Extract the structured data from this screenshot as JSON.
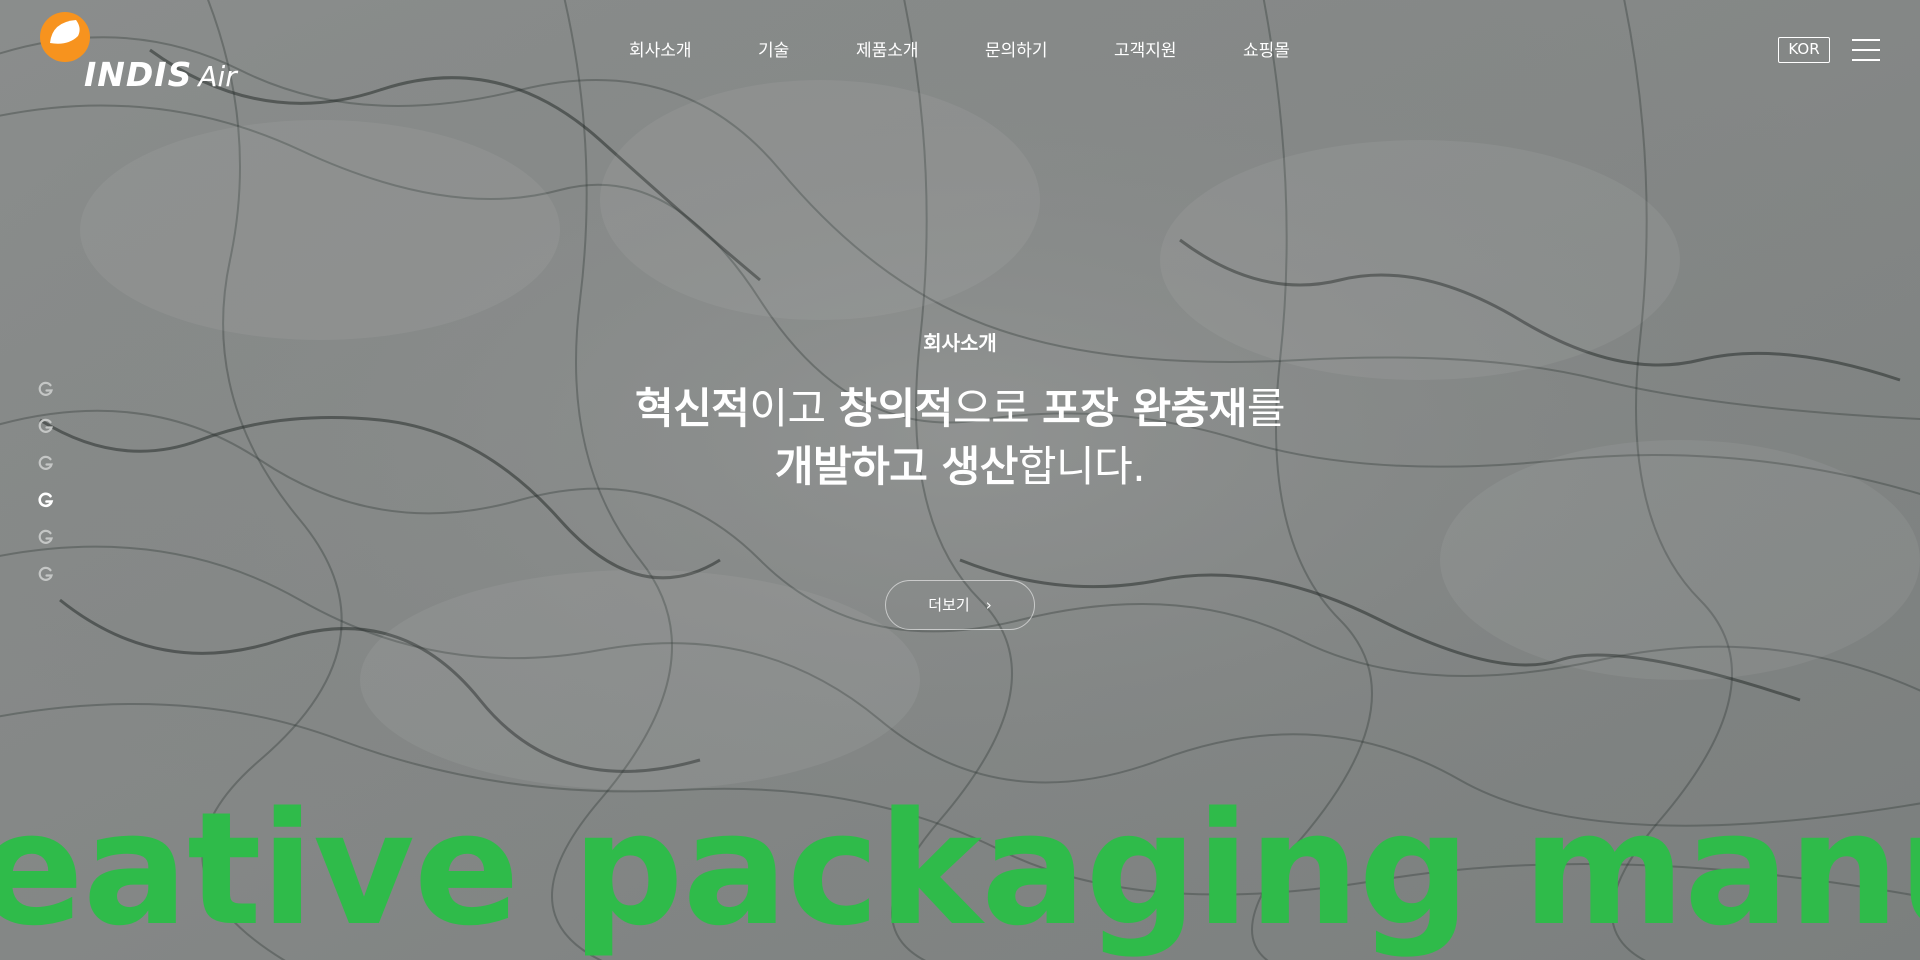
{
  "brand": {
    "name": "INDIS",
    "suffix": "Air",
    "colors": {
      "accent_orange": "#f7931e",
      "marquee_green": "#2fbb4a",
      "text": "#ffffff"
    }
  },
  "nav": {
    "items": [
      {
        "label": "회사소개"
      },
      {
        "label": "기술"
      },
      {
        "label": "제품소개"
      },
      {
        "label": "문의하기"
      },
      {
        "label": "고객지원"
      },
      {
        "label": "쇼핑몰"
      }
    ]
  },
  "header": {
    "language": "KOR",
    "menu_icon": "hamburger-icon"
  },
  "pager": {
    "count": 6,
    "active_index": 3,
    "icon": "g-logo-icon"
  },
  "hero": {
    "kicker": "회사소개",
    "headline": {
      "line1": [
        {
          "text": "혁신적",
          "bold": true
        },
        {
          "text": "이고 ",
          "bold": false
        },
        {
          "text": "창의적",
          "bold": true
        },
        {
          "text": "으로 ",
          "bold": false
        },
        {
          "text": "포장 완충재",
          "bold": true
        },
        {
          "text": "를",
          "bold": false
        }
      ],
      "line2": [
        {
          "text": "개발하고 생산",
          "bold": true
        },
        {
          "text": "합니다.",
          "bold": false
        }
      ]
    },
    "more_button": {
      "label": "더보기",
      "icon": "chevron-right-icon"
    },
    "marquee": "eative packaging manufactu"
  }
}
